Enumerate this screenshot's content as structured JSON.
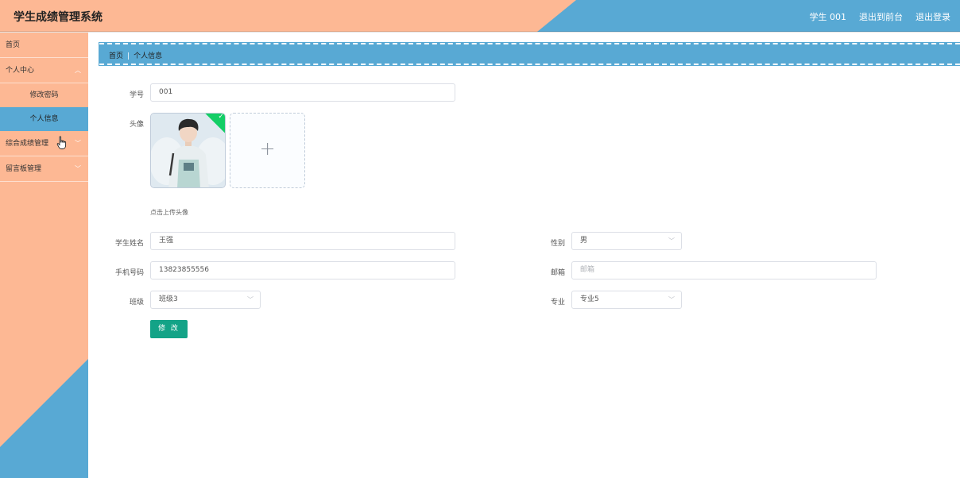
{
  "header": {
    "title": "学生成绩管理系统",
    "user": "学生 001",
    "back_to_front": "退出到前台",
    "logout": "退出登录"
  },
  "sidebar": {
    "items": [
      {
        "label": "首页"
      },
      {
        "label": "个人中心",
        "children": [
          {
            "label": "修改密码"
          },
          {
            "label": "个人信息",
            "active": true
          }
        ]
      },
      {
        "label": "综合成绩管理"
      },
      {
        "label": "留言板管理"
      }
    ]
  },
  "breadcrumb": {
    "home": "首页",
    "current": "个人信息"
  },
  "form": {
    "student_id": {
      "label": "学号",
      "value": "001"
    },
    "avatar": {
      "label": "头像",
      "tip": "点击上传头像"
    },
    "name": {
      "label": "学生姓名",
      "value": "王强"
    },
    "gender": {
      "label": "性别",
      "value": "男"
    },
    "phone": {
      "label": "手机号码",
      "value": "13823855556"
    },
    "email": {
      "label": "邮箱",
      "placeholder": "邮箱"
    },
    "class": {
      "label": "班级",
      "value": "班级3"
    },
    "major": {
      "label": "专业",
      "value": "专业5"
    },
    "submit": "修 改"
  },
  "colors": {
    "accent_blue": "#58a9d4",
    "accent_peach": "#fdb894",
    "button_green": "#13a387"
  }
}
